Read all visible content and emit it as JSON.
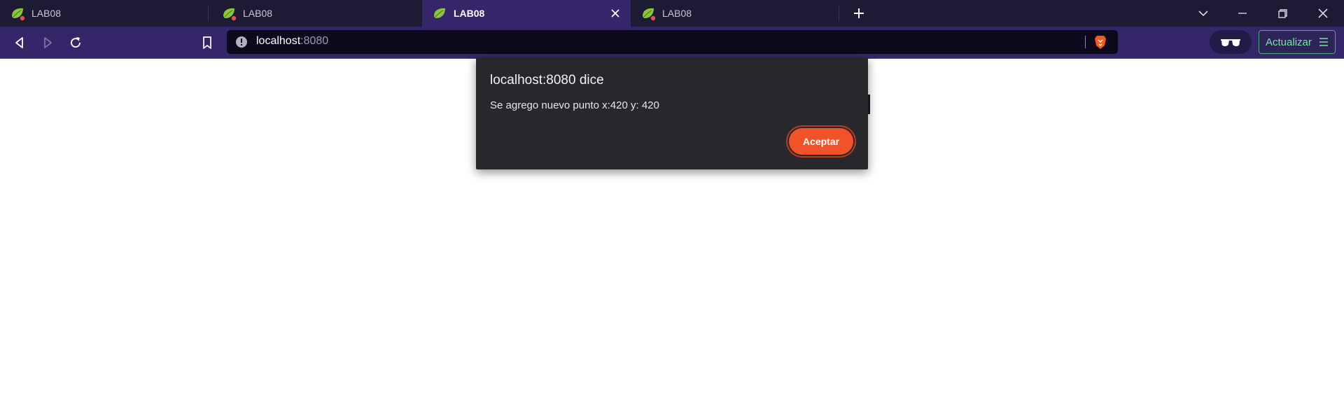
{
  "tabs": [
    {
      "title": "LAB08",
      "active": false,
      "favicon": "spring-leaf-icon"
    },
    {
      "title": "LAB08",
      "active": false,
      "favicon": "spring-leaf-icon"
    },
    {
      "title": "LAB08",
      "active": true,
      "favicon": "spring-leaf-icon"
    },
    {
      "title": "LAB08",
      "active": false,
      "favicon": "spring-leaf-icon"
    }
  ],
  "toolbar": {
    "url_host": "localhost",
    "url_port": ":8080",
    "update_label": "Actualizar"
  },
  "dialog": {
    "title": "localhost:8080 dice",
    "message": "Se agrego nuevo punto x:420 y: 420",
    "accept_label": "Aceptar"
  },
  "colors": {
    "tabstrip": "#1d1a33",
    "toolbar": "#352669",
    "dialog": "#28282c",
    "accept": "#f2522a"
  }
}
